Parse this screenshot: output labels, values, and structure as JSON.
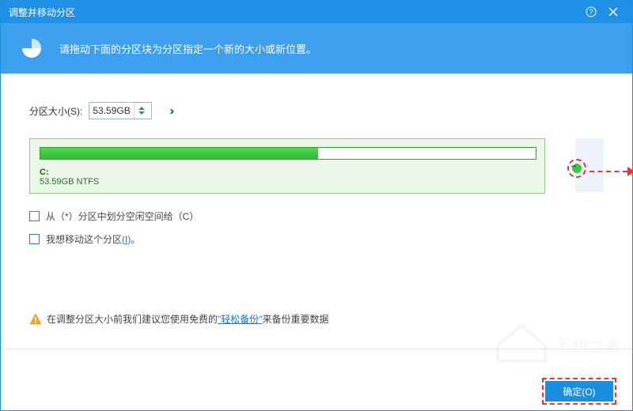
{
  "titlebar": {
    "title": "调整并移动分区"
  },
  "banner": {
    "text": "请拖动下面的分区块为分区指定一个新的大小或新位置。"
  },
  "size_row": {
    "label": "分区大小(S):",
    "value": "53.59GB"
  },
  "partition": {
    "drive": "C:",
    "desc": "53.59GB NTFS",
    "fill_percent": 56
  },
  "checkboxes": {
    "carve_label_pre": "从（*）分区中划分空闲空间给（",
    "carve_drive": "C",
    "carve_label_post": "）",
    "move_label": "我想移动这个分区",
    "move_link": "(I)",
    "move_suffix": "。"
  },
  "warning": {
    "pre": "在调整分区大小前我们建议您使用免费的 ",
    "link": "\"轻松备份\"",
    "post": " 来备份重要数据"
  },
  "footer": {
    "ok": "确定(O)"
  },
  "colors": {
    "primary": "#1b8ee0",
    "green": "#3fc83f",
    "red": "#e33"
  }
}
